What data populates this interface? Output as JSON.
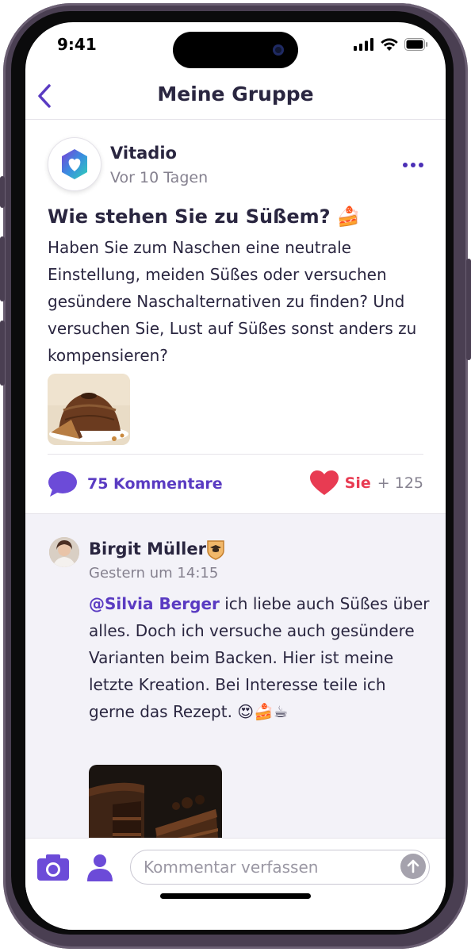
{
  "status_bar": {
    "time": "9:41"
  },
  "nav": {
    "title": "Meine Gruppe"
  },
  "post": {
    "author": "Vitadio",
    "time": "Vor 10 Tagen",
    "title": "Wie stehen Sie zu Süßem? 🍰",
    "body": "Haben Sie zum Naschen eine neutrale Einstellung, meiden Süßes oder versuchen gesündere Naschalternativen zu finden? Und versuchen Sie, Lust auf Süßes sonst anders zu kompensieren?",
    "comments_label": "75 Kommentare",
    "like_you": "Sie",
    "like_count": "+ 125"
  },
  "comment": {
    "author": "Birgit Müller",
    "time": "Gestern um 14:15",
    "mention": "@Silvia Berger",
    "text": " ich liebe auch Süßes über alles. Doch ich versuche auch gesündere Varianten beim Backen. Hier ist meine letzte Kreation. Bei Interesse teile ich gerne das Rezept. 😍🍰☕"
  },
  "composer": {
    "placeholder": "Kommentar verfassen"
  },
  "colors": {
    "accent": "#5a3bc2",
    "like": "#e83b52",
    "text": "#2a2640",
    "muted": "#85818f"
  }
}
